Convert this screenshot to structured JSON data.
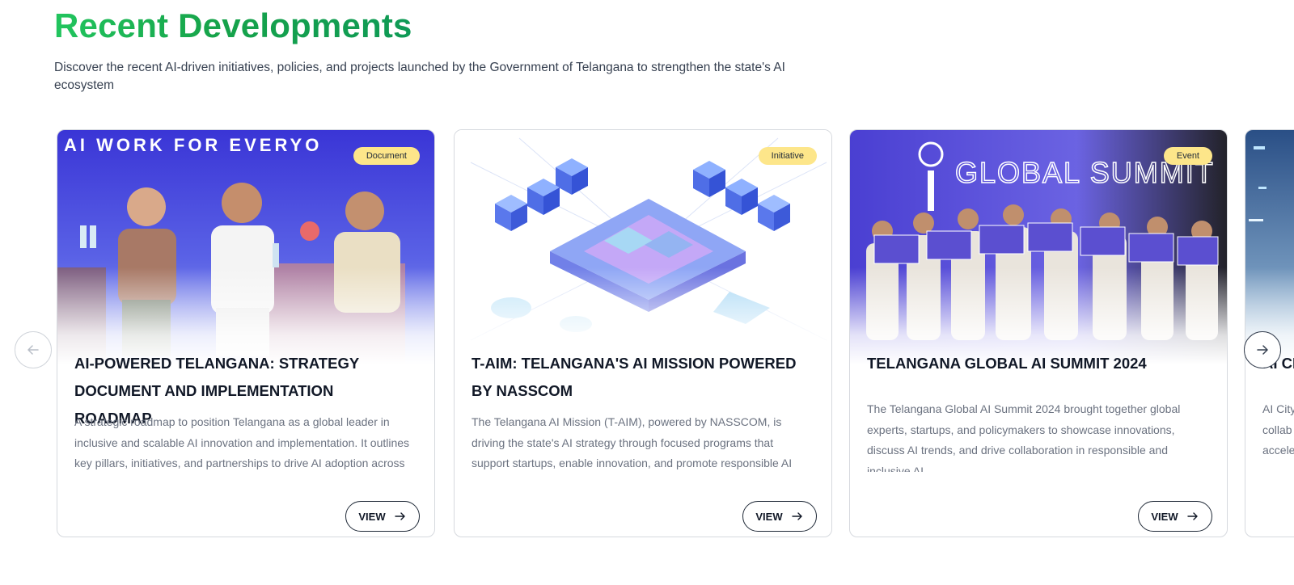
{
  "section": {
    "title": "Recent Developments",
    "description": "Discover the recent AI-driven initiatives, policies, and projects launched by the Government of Telangana to strengthen the state's AI ecosystem"
  },
  "cards": [
    {
      "badge": "Document",
      "image_text": "AI WORK FOR EVERYO",
      "title": "AI-POWERED TELANGANA: STRATEGY DOCUMENT AND IMPLEMENTATION ROADMAP",
      "description": "A strategic roadmap to position Telangana as a global leader in inclusive and scalable AI innovation and implementation. It outlines key pillars, initiatives, and partnerships to drive AI adoption across governance, industry, and society.",
      "button_label": "VIEW"
    },
    {
      "badge": "Initiative",
      "title": "T-AIM: TELANGANA'S AI MISSION POWERED BY NASSCOM",
      "description": "The Telangana AI Mission (T-AIM), powered by NASSCOM, is driving the state's AI strategy through focused programs that support startups, enable innovation, and promote responsible AI adoption across sectors.",
      "button_label": "VIEW"
    },
    {
      "badge": "Event",
      "image_text": "GLOBAL SUMMIT",
      "title": "TELANGANA GLOBAL AI SUMMIT 2024",
      "description": "The Telangana Global AI Summit 2024 brought together global experts, startups, and policymakers to showcase innovations, discuss AI trends, and drive collaboration in responsible and inclusive AI.",
      "button_label": "VIEW"
    },
    {
      "title": "AI CI",
      "description_lines": [
        "AI City",
        "collab",
        "accele"
      ]
    }
  ],
  "nav": {
    "prev_icon": "arrow-left-icon",
    "next_icon": "arrow-right-icon"
  },
  "colors": {
    "title_gradient_start": "#22c55e",
    "title_gradient_end": "#0f9a56",
    "badge_bg": "#fde68a",
    "card_border": "#d6d9de"
  }
}
